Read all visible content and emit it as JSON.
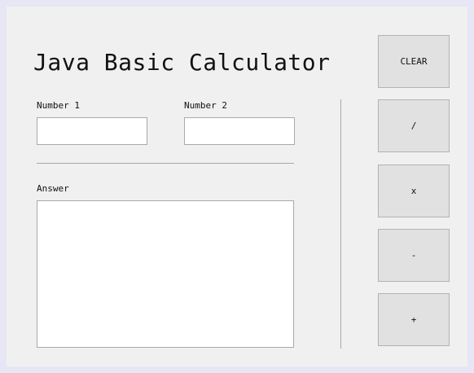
{
  "app": {
    "title": "Java Basic Calculator"
  },
  "inputs": {
    "number1_label": "Number 1",
    "number1_value": "",
    "number2_label": "Number 2",
    "number2_value": "",
    "answer_label": "Answer",
    "answer_value": ""
  },
  "buttons": {
    "clear": "CLEAR",
    "divide": "/",
    "multiply": "x",
    "subtract": "-",
    "add": "+"
  },
  "colors": {
    "background": "#f0f0f0",
    "button": "#e1e1e1",
    "field": "#ffffff"
  }
}
